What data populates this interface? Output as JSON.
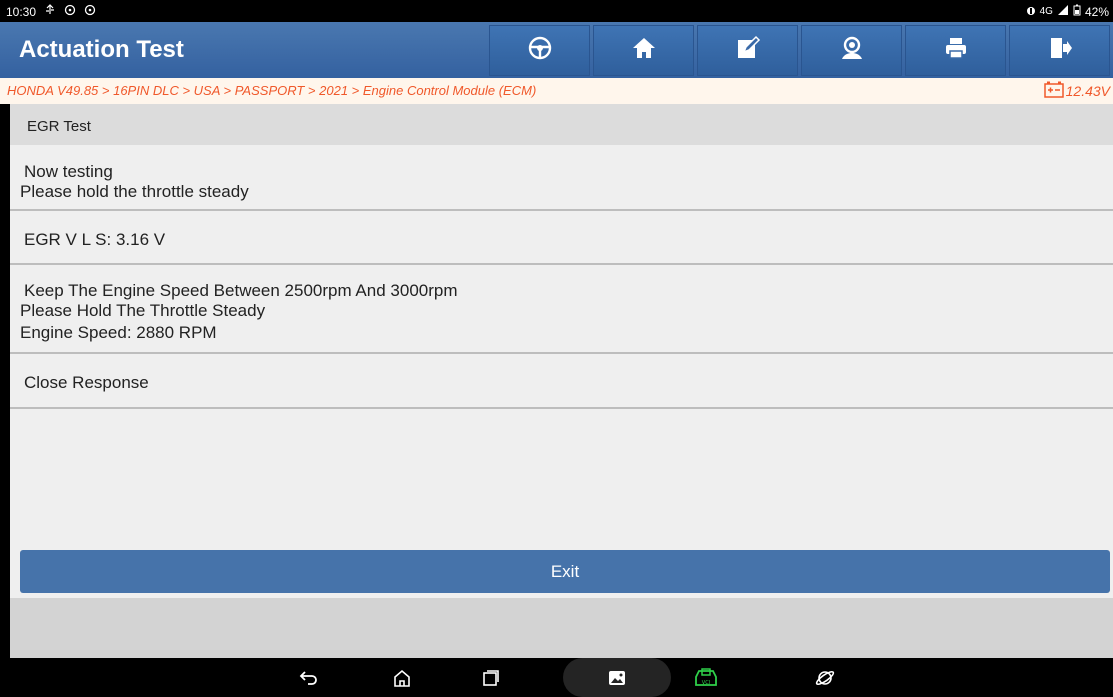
{
  "status_bar": {
    "time": "10:30",
    "left_icons": [
      "usb-icon",
      "chat-icon",
      "chat-icon"
    ],
    "network": "4G",
    "battery": "42%"
  },
  "header": {
    "title": "Actuation Test",
    "buttons": [
      {
        "name": "diagnose-button",
        "icon": "steering-icon"
      },
      {
        "name": "home-button",
        "icon": "home-icon"
      },
      {
        "name": "report-button",
        "icon": "edit-icon"
      },
      {
        "name": "feedback-button",
        "icon": "support-icon"
      },
      {
        "name": "print-button",
        "icon": "printer-icon"
      },
      {
        "name": "exit-app-button",
        "icon": "exit-door-icon"
      }
    ]
  },
  "breadcrumb": {
    "path": "HONDA V49.85 > 16PIN DLC > USA > PASSPORT > 2021 > Engine Control Module (ECM)",
    "voltage": "12.43V"
  },
  "panel": {
    "title": "EGR Test",
    "rows": [
      {
        "lines": [
          "Now testing",
          "Please hold the throttle steady"
        ]
      },
      {
        "lines": [
          "EGR V L S: 3.16 V"
        ]
      },
      {
        "lines": [
          "Keep The Engine Speed Between 2500rpm And 3000rpm",
          "Please Hold The Throttle Steady",
          "Engine Speed: 2880 RPM"
        ]
      },
      {
        "lines": [
          "Close Response"
        ]
      }
    ]
  },
  "actions": {
    "exit_label": "Exit"
  },
  "colors": {
    "accent": "#3f6fab",
    "breadcrumb_text": "#f0582a"
  }
}
